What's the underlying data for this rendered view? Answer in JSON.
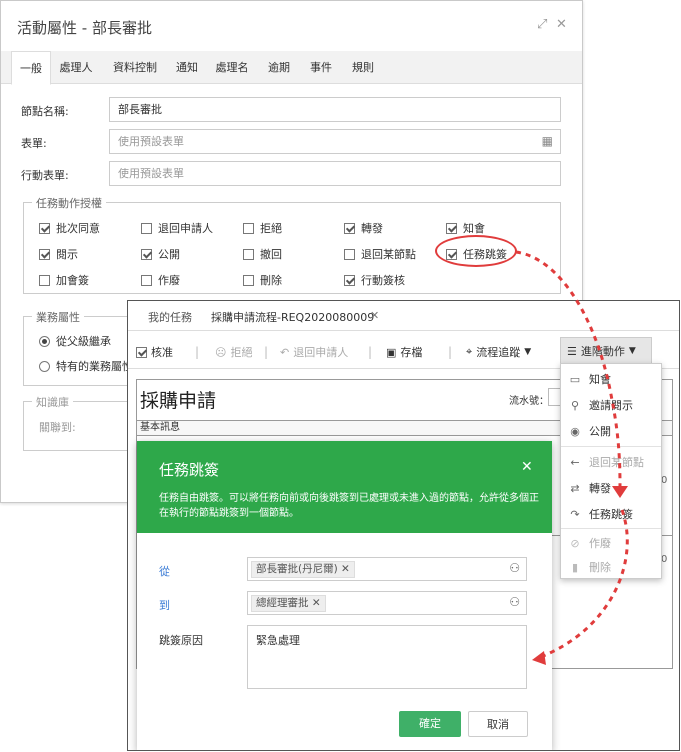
{
  "props_window": {
    "title": "活動屬性 - 部長審批",
    "tabs": [
      "一般",
      "處理人",
      "資料控制",
      "通知",
      "處理名",
      "逾期",
      "事件",
      "規則"
    ],
    "node_name_label": "節點名稱:",
    "node_name_value": "部長審批",
    "form_label": "表單:",
    "form_placeholder": "使用預設表單",
    "mobile_form_label": "行動表單:",
    "mobile_form_placeholder": "使用預設表單",
    "task_auth_legend": "任務動作授權",
    "checkboxes": [
      {
        "label": "批次同意",
        "checked": true
      },
      {
        "label": "退回申請人",
        "checked": false
      },
      {
        "label": "拒絕",
        "checked": false
      },
      {
        "label": "轉發",
        "checked": true
      },
      {
        "label": "知會",
        "checked": true
      },
      {
        "label": "閱示",
        "checked": true
      },
      {
        "label": "公開",
        "checked": true
      },
      {
        "label": "撤回",
        "checked": false
      },
      {
        "label": "退回某節點",
        "checked": false
      },
      {
        "label": "任務跳簽",
        "checked": true
      },
      {
        "label": "加會簽",
        "checked": false
      },
      {
        "label": "作廢",
        "checked": false
      },
      {
        "label": "刪除",
        "checked": false
      },
      {
        "label": "行動簽核",
        "checked": true
      }
    ],
    "business_legend": "業務屬性",
    "radio_inherit": "從父級繼承",
    "radio_own": "特有的業務屬性",
    "knowledge_legend": "知識庫",
    "knowledge_link_label": "關聯到:"
  },
  "task_window": {
    "tab_my_tasks": "我的任務",
    "tab_flow": "採購申請流程-REQ2020080009",
    "toolbar": {
      "approve": "核准",
      "reject": "拒絕",
      "return_applicant": "退回申請人",
      "save": "存檔",
      "trace": "流程追蹤",
      "advanced": "進階動作"
    },
    "doc_title": "採購申請",
    "serial_label": "流水號：",
    "section_basic": "基本訊息",
    "dropdown": [
      {
        "label": "知會",
        "icon": "comment-icon",
        "enabled": true
      },
      {
        "label": "邀請閱示",
        "icon": "user-plus-icon",
        "enabled": true
      },
      {
        "label": "公開",
        "icon": "eye-icon",
        "enabled": true
      },
      {
        "label": "退回某節點",
        "icon": "arrow-left-icon",
        "enabled": false
      },
      {
        "label": "轉發",
        "icon": "transfer-icon",
        "enabled": true
      },
      {
        "label": "任務跳簽",
        "icon": "jump-icon",
        "enabled": true
      },
      {
        "label": "作廢",
        "icon": "ban-icon",
        "enabled": false
      },
      {
        "label": "刪除",
        "icon": "trash-icon",
        "enabled": false
      }
    ],
    "modal": {
      "title": "任務跳簽",
      "description": "任務自由跳簽。可以將任務向前或向後跳簽到已處理或未進入過的節點，允許從多個正在執行的節點跳簽到一個節點。",
      "from_label": "從",
      "from_tag": "部長審批(丹尼爾)",
      "to_label": "到",
      "to_tag": "總經理審批",
      "reason_label": "跳簽原因",
      "reason_value": "緊急處理",
      "ok": "確定",
      "cancel": "取消"
    }
  },
  "colors": {
    "accent_green": "#2ea84a",
    "highlight_red": "#e03c3c",
    "link_blue": "#3a7bd5"
  }
}
